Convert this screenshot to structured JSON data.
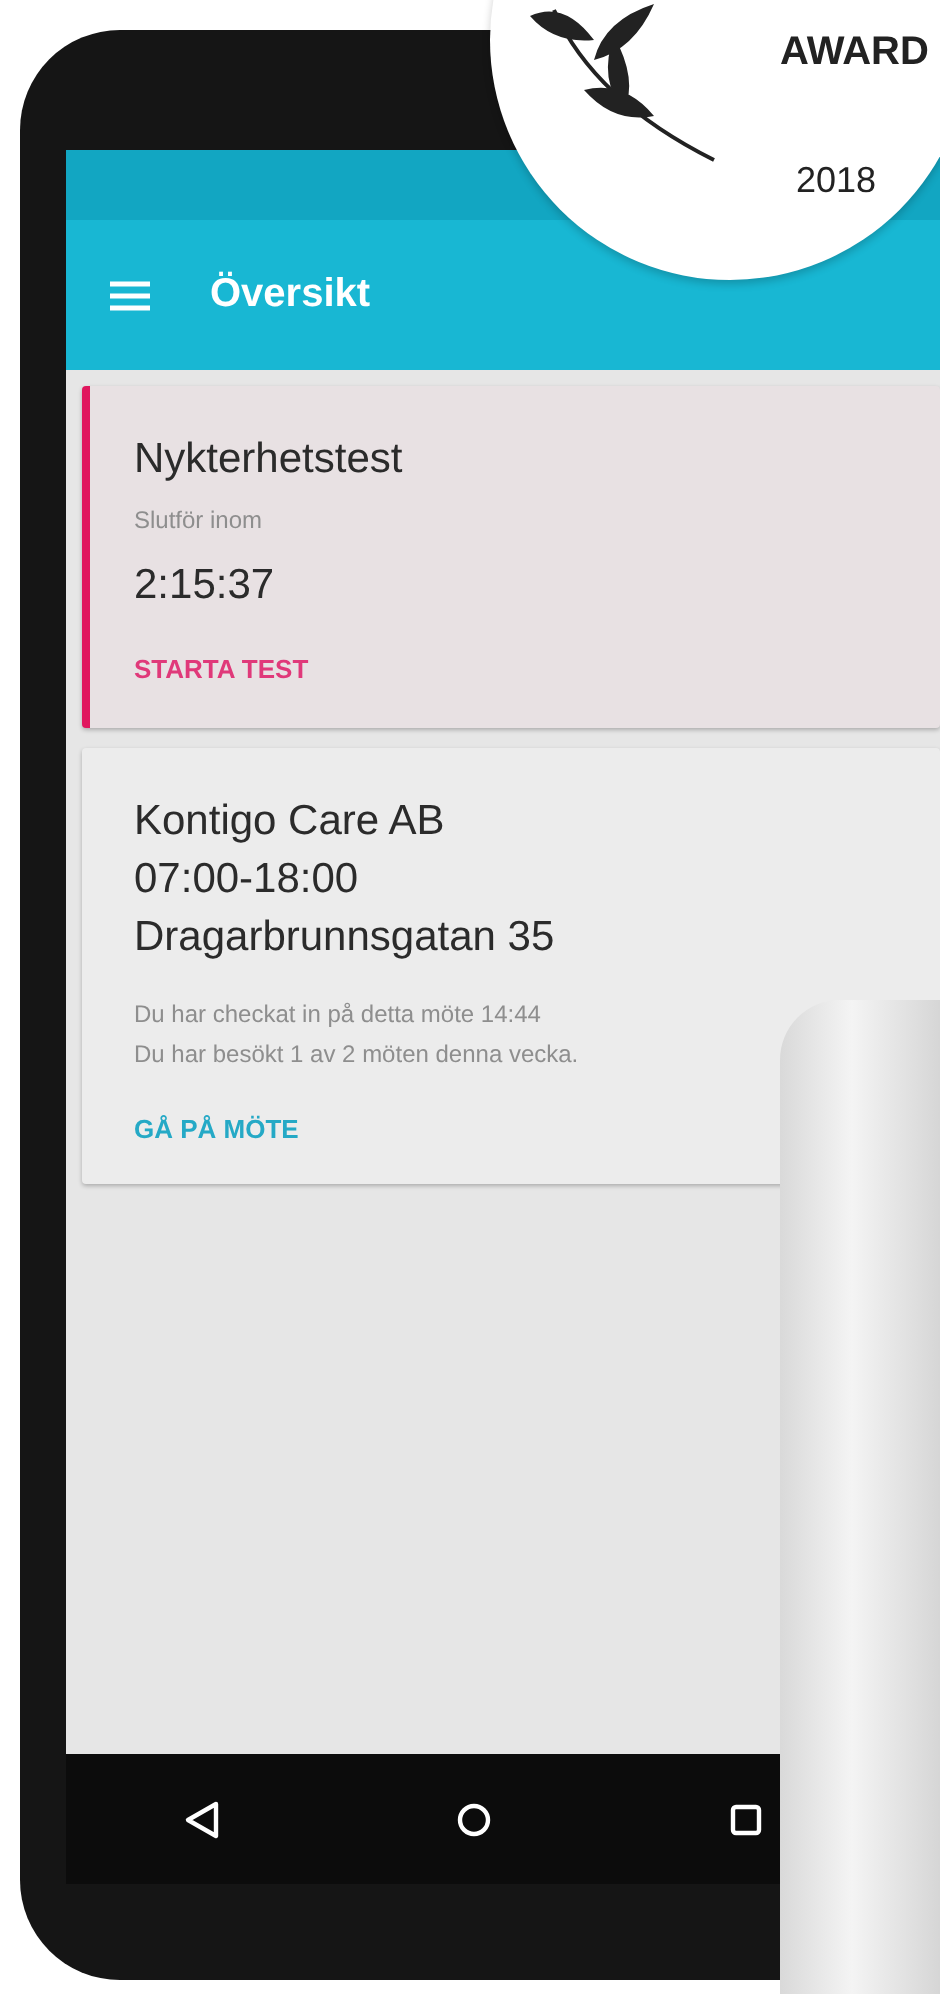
{
  "badge": {
    "title": "AWARD",
    "year": "2018"
  },
  "app_bar": {
    "title": "Översikt"
  },
  "cards": [
    {
      "kind": "test",
      "title": "Nykterhetstest",
      "subtitle": "Slutför inom",
      "timer": "2:15:37",
      "action": "STARTA TEST"
    },
    {
      "kind": "meeting",
      "lines": [
        "Kontigo Care AB",
        "07:00-18:00",
        "Dragarbrunnsgatan 35"
      ],
      "notes": [
        "Du har checkat in på detta möte 14:44",
        "Du har besökt 1 av 2 möten denna vecka."
      ],
      "action": "GÅ PÅ MÖTE"
    }
  ]
}
